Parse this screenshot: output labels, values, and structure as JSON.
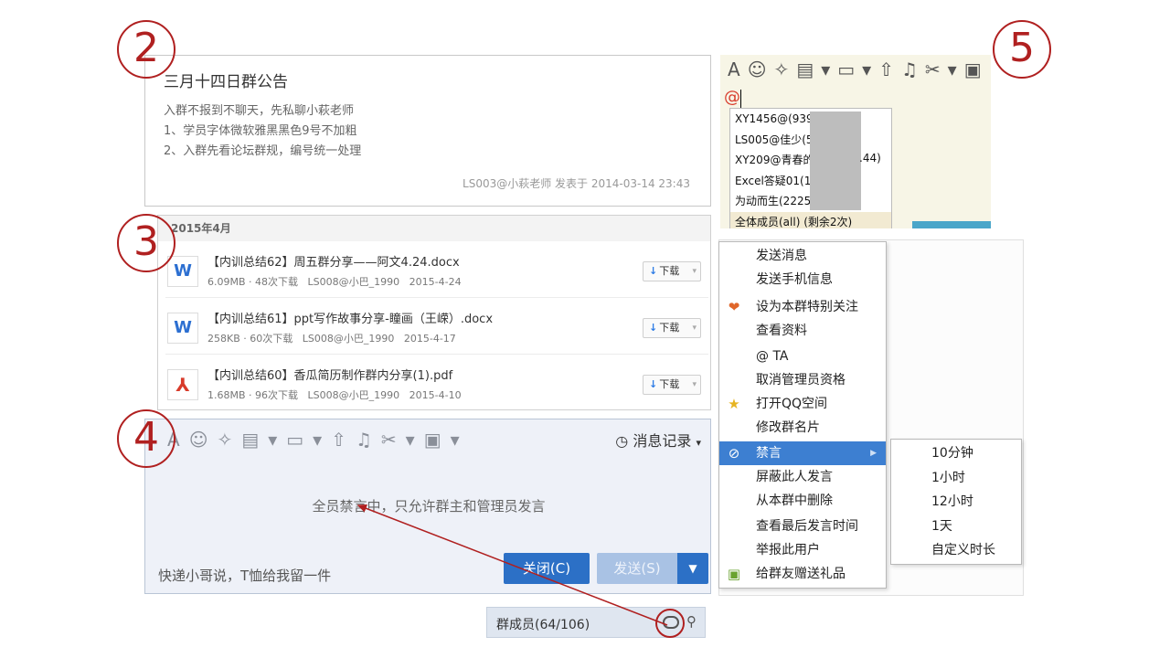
{
  "markers": {
    "m2": "2",
    "m3": "3",
    "m4": "4",
    "m5": "5"
  },
  "announcement": {
    "title": "三月十四日群公告",
    "lines": [
      "入群不报到不聊天，先私聊小萩老师",
      "1、学员字体微软雅黑黑色9号不加粗",
      "2、入群先看论坛群规，编号统一处理"
    ],
    "footer": "LS003@小萩老师 发表于 2014-03-14 23:43"
  },
  "files": {
    "month": "2015年4月",
    "download_label": "下载",
    "items": [
      {
        "icon": "word-icon",
        "name": "【内训总结62】周五群分享——阿文4.24.docx",
        "size": "6.09MB",
        "downloads": "48次下载",
        "uploader": "LS008@小巴_1990",
        "date": "2015-4-24"
      },
      {
        "icon": "word-icon",
        "name": "【内训总结61】ppt写作故事分享-瞳画（王嵘）.docx",
        "size": "258KB",
        "downloads": "60次下载",
        "uploader": "LS008@小巴_1990",
        "date": "2015-4-17"
      },
      {
        "icon": "pdf-icon",
        "name": "【内训总结60】香瓜简历制作群内分享(1).pdf",
        "size": "1.68MB",
        "downloads": "96次下载",
        "uploader": "LS008@小巴_1990",
        "date": "2015-4-10"
      }
    ]
  },
  "chat": {
    "history_label": "消息记录",
    "muted_text": "全员禁言中，只允许群主和管理员发言",
    "tip": "快递小哥说，T恤给我留一件",
    "close_label": "关闭(C)",
    "send_label": "发送(S)"
  },
  "members": {
    "label": "群成员(64/106)"
  },
  "mention": {
    "at_symbol": "@",
    "items": [
      "XY1456@(93959",
      "LS005@佳少(58",
      "XY209@青春的",
      "Excel答疑01(10",
      "为动而生(2225",
      "全体成员(all) (剩余2次)"
    ],
    "tail_text": ".44)"
  },
  "context_menu": {
    "items": [
      {
        "label": "发送消息",
        "icon": ""
      },
      {
        "label": "发送手机信息",
        "icon": ""
      },
      {
        "label": "设为本群特别关注",
        "icon": "heart-icon"
      },
      {
        "label": "查看资料",
        "icon": ""
      },
      {
        "label": "@ TA",
        "icon": ""
      },
      {
        "label": "取消管理员资格",
        "icon": ""
      },
      {
        "label": "打开QQ空间",
        "icon": "star-icon"
      },
      {
        "label": "修改群名片",
        "icon": ""
      },
      {
        "label": "禁言",
        "icon": "mute-icon"
      },
      {
        "label": "屏蔽此人发言",
        "icon": ""
      },
      {
        "label": "从本群中删除",
        "icon": ""
      },
      {
        "label": "查看最后发言时间",
        "icon": ""
      },
      {
        "label": "举报此用户",
        "icon": ""
      },
      {
        "label": "给群友赠送礼品",
        "icon": "gift-icon"
      }
    ],
    "submenu": [
      "10分钟",
      "1小时",
      "12小时",
      "1天",
      "自定义时长"
    ]
  },
  "colors": {
    "marker": "#b02020",
    "highlight": "#3d7fd1",
    "primary_button": "#2c70c6"
  }
}
